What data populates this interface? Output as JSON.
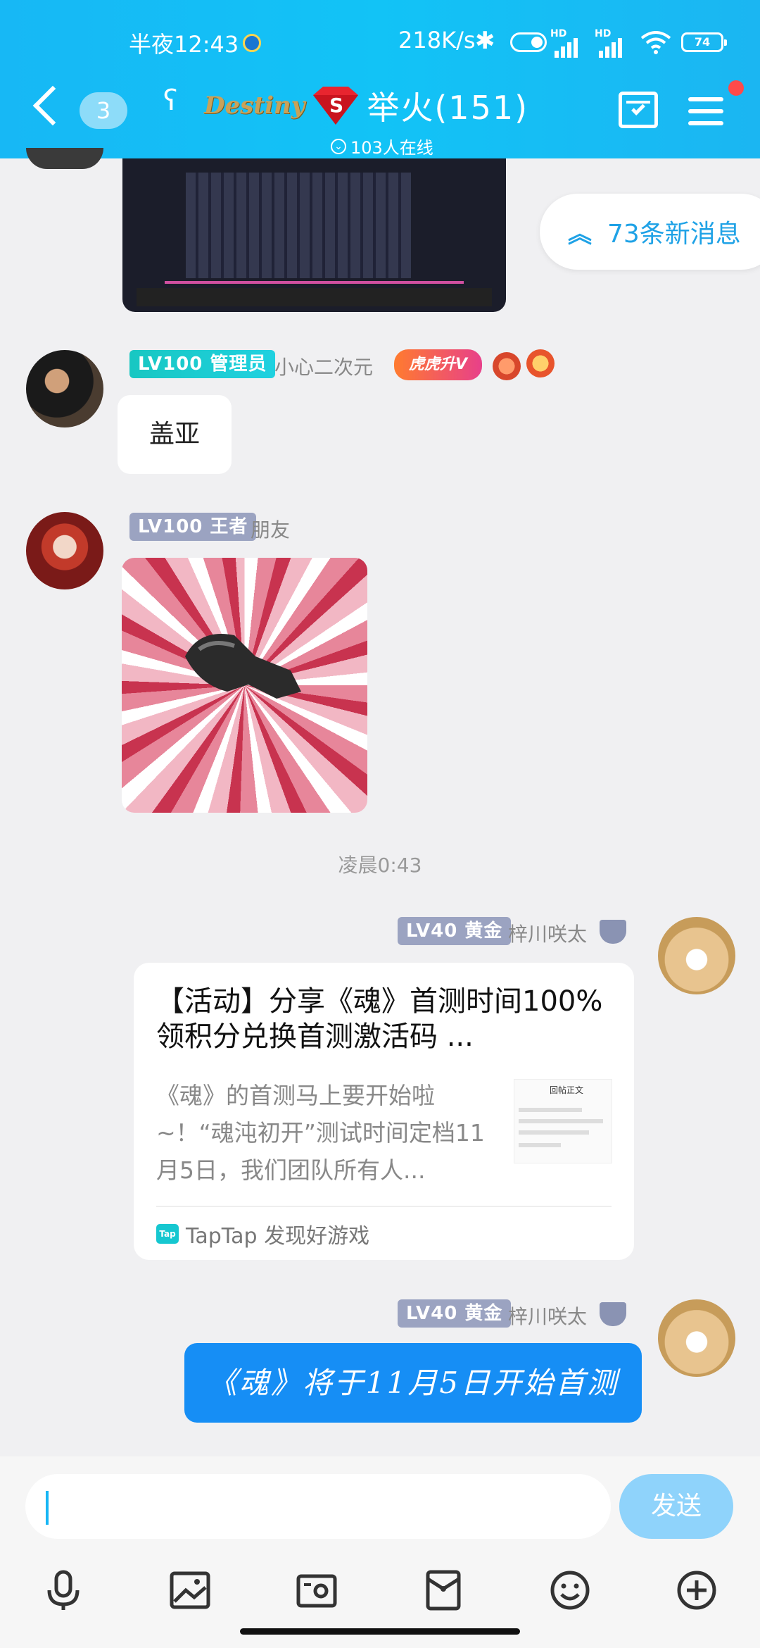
{
  "status_bar": {
    "time": "半夜12:43",
    "net_rate": "218K/s",
    "sim1": "HD",
    "sim2": "HD",
    "battery": "74"
  },
  "header": {
    "unread_count": "3",
    "brand_text": "Destiny",
    "group_name": "举火(151)",
    "online": "103人在线"
  },
  "new_messages": "73条新消息",
  "messages": [
    {
      "badge": "LV100 管理员",
      "nickname": "小心二次元",
      "honor": "虎虎升V",
      "text": "盖亚"
    },
    {
      "badge": "LV100 王者",
      "nickname": "朋友"
    }
  ],
  "timestamp": "凌晨0:43",
  "share_card": {
    "badge": "LV40 黄金",
    "nickname": "梓川咲太",
    "title": "【活动】分享《魂》首测时间100%领积分兑换首测激活码 ...",
    "description": "《魂》的首测马上要开始啦~！“魂沌初开”测试时间定档11月5日，我们团队所有人...",
    "thumb_title": "回帖正文",
    "source_icon": "Tap",
    "source": "TapTap 发现好游戏"
  },
  "last_message": {
    "badge": "LV40 黄金",
    "nickname": "梓川咲太",
    "text": "《魂》将于11月5日开始首测"
  },
  "input": {
    "placeholder": "",
    "send_label": "发送"
  },
  "toolbar_icons": [
    "mic-icon",
    "image-icon",
    "camera-icon",
    "red-packet-icon",
    "emoji-icon",
    "plus-icon"
  ]
}
